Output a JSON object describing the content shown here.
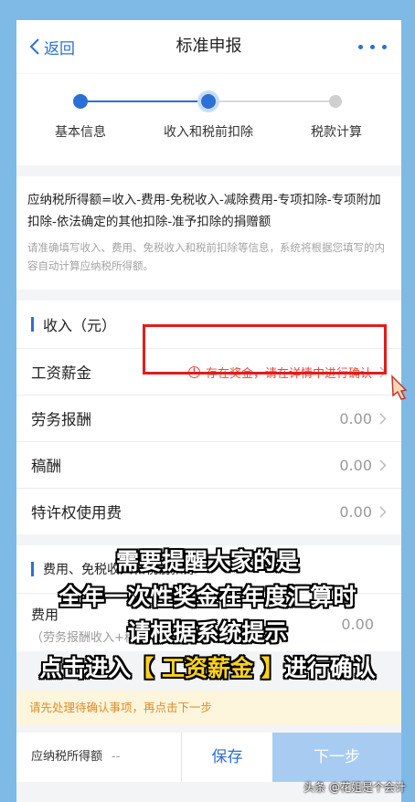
{
  "nav": {
    "back_label": "返回",
    "title": "标准申报"
  },
  "steps": [
    {
      "label": "基本信息"
    },
    {
      "label": "收入和税前扣除"
    },
    {
      "label": "税款计算"
    }
  ],
  "formula": {
    "text": "应纳税所得额=收入-费用-免税收入-减除费用-专项扣除-专项附加扣除-依法确定的其他扣除-准予扣除的捐赠额",
    "hint": "请准确填写收入、费用、免税收入和税前扣除等信息，系统将根据您填写的内容自动计算应纳税所得额。"
  },
  "income": {
    "title": "收入（元）",
    "rows": [
      {
        "label": "工资薪金",
        "warning": "存在奖金，请在详情中进行确认"
      },
      {
        "label": "劳务报酬",
        "value": "0.00"
      },
      {
        "label": "稿酬",
        "value": "0.00"
      },
      {
        "label": "特许权使用费",
        "value": "0.00"
      }
    ]
  },
  "expense": {
    "title": "费用、免税收入和税前扣除",
    "row_label": "费用",
    "row_sub": "（劳务报酬收入+稿酬收入+特许权使用费收入）",
    "row_value": "0.00"
  },
  "notice": "请先处理待确认事项，再点击下一步",
  "bottom": {
    "tax_label": "应纳税所得额",
    "tax_value": "--",
    "save_label": "保存",
    "next_label": "下一步"
  },
  "caption": {
    "line1": "需要提醒大家的是",
    "line2": "全年一次性奖金在年度汇算时",
    "line3": "请根据系统提示",
    "line4_pre": "点击进入",
    "line4_hl": "【 工资薪金 】",
    "line4_post": "进行确认"
  },
  "watermark": "头条 @花姐是个会计",
  "colors": {
    "accent": "#2c6fd6",
    "warning": "#e54a3a",
    "highlight_box": "#e41b1b",
    "notice_text": "#e08a2a"
  }
}
